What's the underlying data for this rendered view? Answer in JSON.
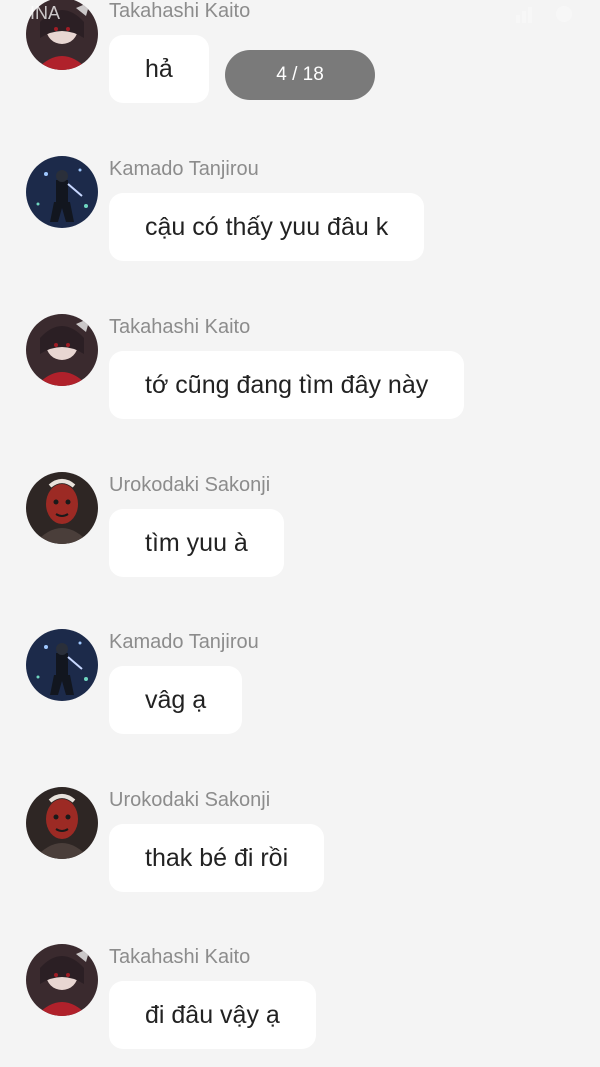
{
  "status_bar": {
    "carrier": "INA"
  },
  "pager": {
    "label": "4 / 18"
  },
  "messages": [
    {
      "sender": "Takahashi Kaito",
      "text": "hả",
      "avatar": "kaito-avatar"
    },
    {
      "sender": "Kamado Tanjirou",
      "text": "cậu có thấy yuu đâu k",
      "avatar": "tanjirou-avatar"
    },
    {
      "sender": "Takahashi Kaito",
      "text": "tớ cũng đang tìm đây này",
      "avatar": "kaito-avatar"
    },
    {
      "sender": "Urokodaki Sakonji",
      "text": "tìm yuu à",
      "avatar": "sakonji-avatar"
    },
    {
      "sender": "Kamado Tanjirou",
      "text": "vâg ạ",
      "avatar": "tanjirou-avatar"
    },
    {
      "sender": "Urokodaki Sakonji",
      "text": "thak bé đi rồi",
      "avatar": "sakonji-avatar"
    },
    {
      "sender": "Takahashi Kaito",
      "text": "đi đâu vậy ạ",
      "avatar": "kaito-avatar"
    }
  ]
}
